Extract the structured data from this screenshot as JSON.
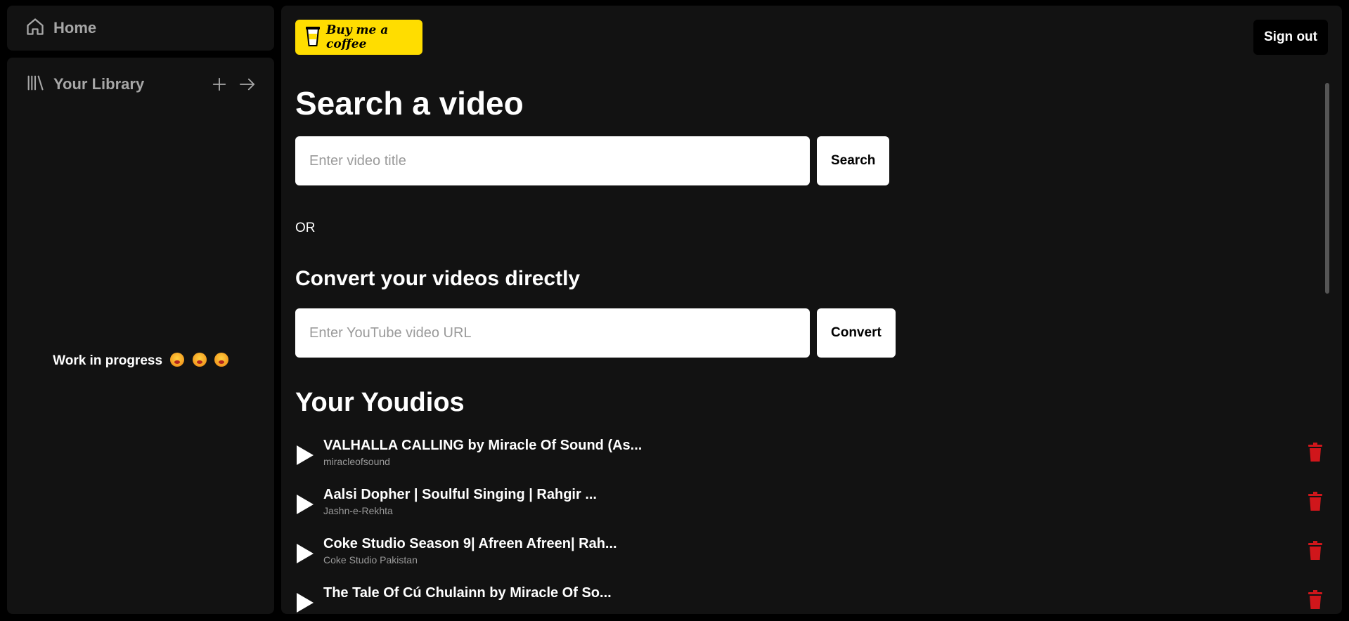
{
  "sidebar": {
    "home_label": "Home",
    "library_label": "Your Library",
    "work_in_progress": "Work in progress"
  },
  "header": {
    "coffee_label": "Buy me a coffee",
    "signout_label": "Sign out"
  },
  "search": {
    "title": "Search a video",
    "placeholder": "Enter video title",
    "button": "Search"
  },
  "or_text": "OR",
  "convert": {
    "title": "Convert your videos directly",
    "placeholder": "Enter YouTube video URL",
    "button": "Convert"
  },
  "youdios": {
    "title": "Your Youdios",
    "items": [
      {
        "title": "VALHALLA CALLING by Miracle Of Sound (As...",
        "artist": "miracleofsound"
      },
      {
        "title": "Aalsi Dopher | Soulful Singing | Rahgir ...",
        "artist": "Jashn-e-Rekhta"
      },
      {
        "title": "Coke Studio Season 9| Afreen Afreen| Rah...",
        "artist": "Coke Studio Pakistan"
      },
      {
        "title": "The Tale Of Cú Chulainn by Miracle Of So...",
        "artist": ""
      }
    ]
  },
  "colors": {
    "accent_yellow": "#ffdd00",
    "delete_red": "#d0161b",
    "panel": "#121212"
  }
}
